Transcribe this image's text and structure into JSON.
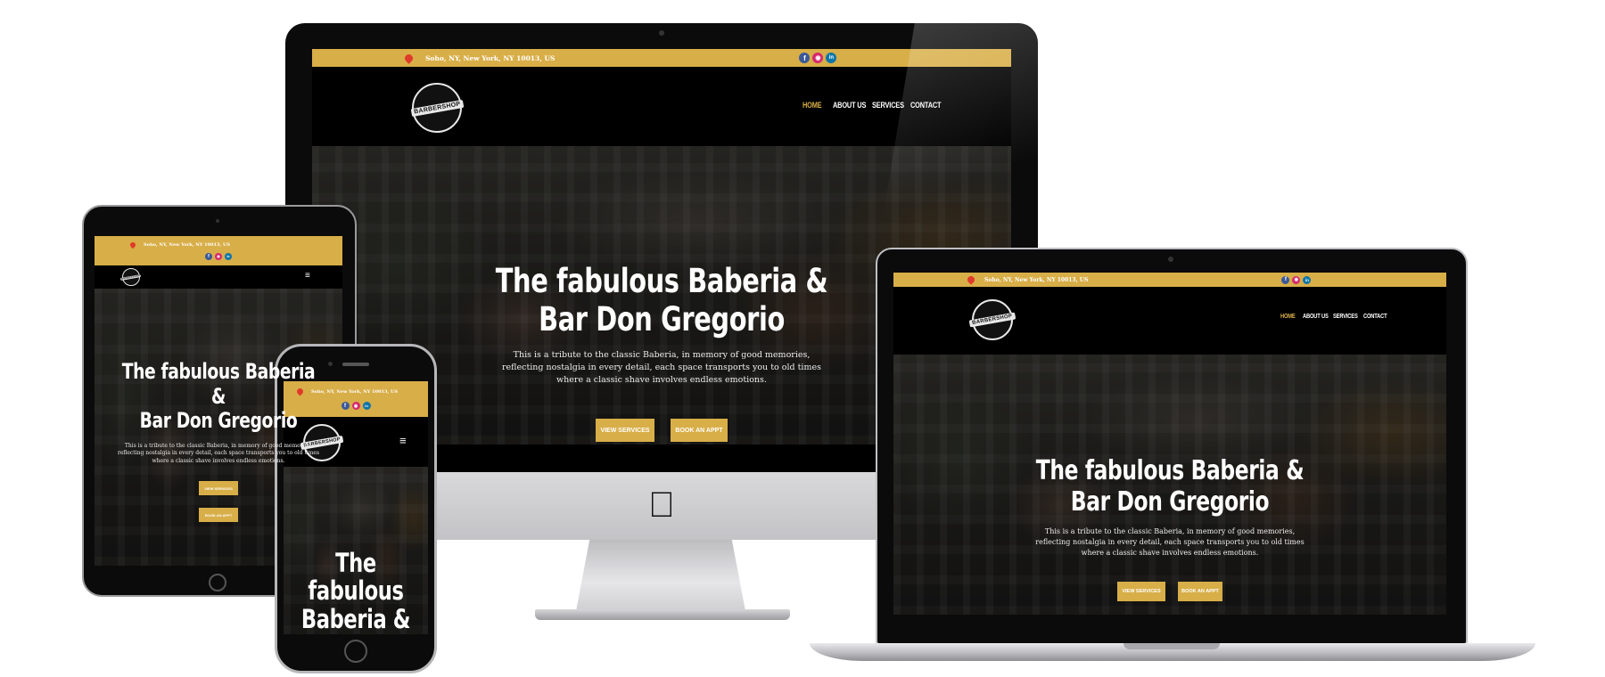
{
  "site": {
    "address": "Soho, NY, New York, NY 10013, US",
    "logo_text": "BARBERSHOP",
    "nav": [
      "HOME",
      "ABOUT US",
      "SERVICES",
      "CONTACT"
    ],
    "hero_title": "The fabulous Baberia &\nBar Don Gregorio",
    "hero_desc": "This is a tribute to the classic Baberia, in memory of good memories,\nreflecting nostalgia in every detail, each space transports you to old times\nwhere a classic shave involves endless emotions.",
    "btn_services": "VIEW SERVICES",
    "btn_appt": "BOOK AN APPT",
    "socials": [
      "facebook-icon",
      "instagram-icon",
      "linkedin-icon"
    ]
  },
  "tablet": {
    "hero_title": "The fabulous Baberia &\nBar Don Gregorio",
    "hero_desc": "This is a tribute to the classic Baberia, in memory of good memories,\nreflecting nostalgia in every detail, each space transports you to old times\nwhere a classic shave involves endless emotions."
  },
  "phone": {
    "hero_title": "The fabulous\nBaberia &\nBar Don"
  },
  "colors": {
    "accent": "#d8ae48",
    "nav_bg": "#000000",
    "pin": "#e03a2a"
  }
}
